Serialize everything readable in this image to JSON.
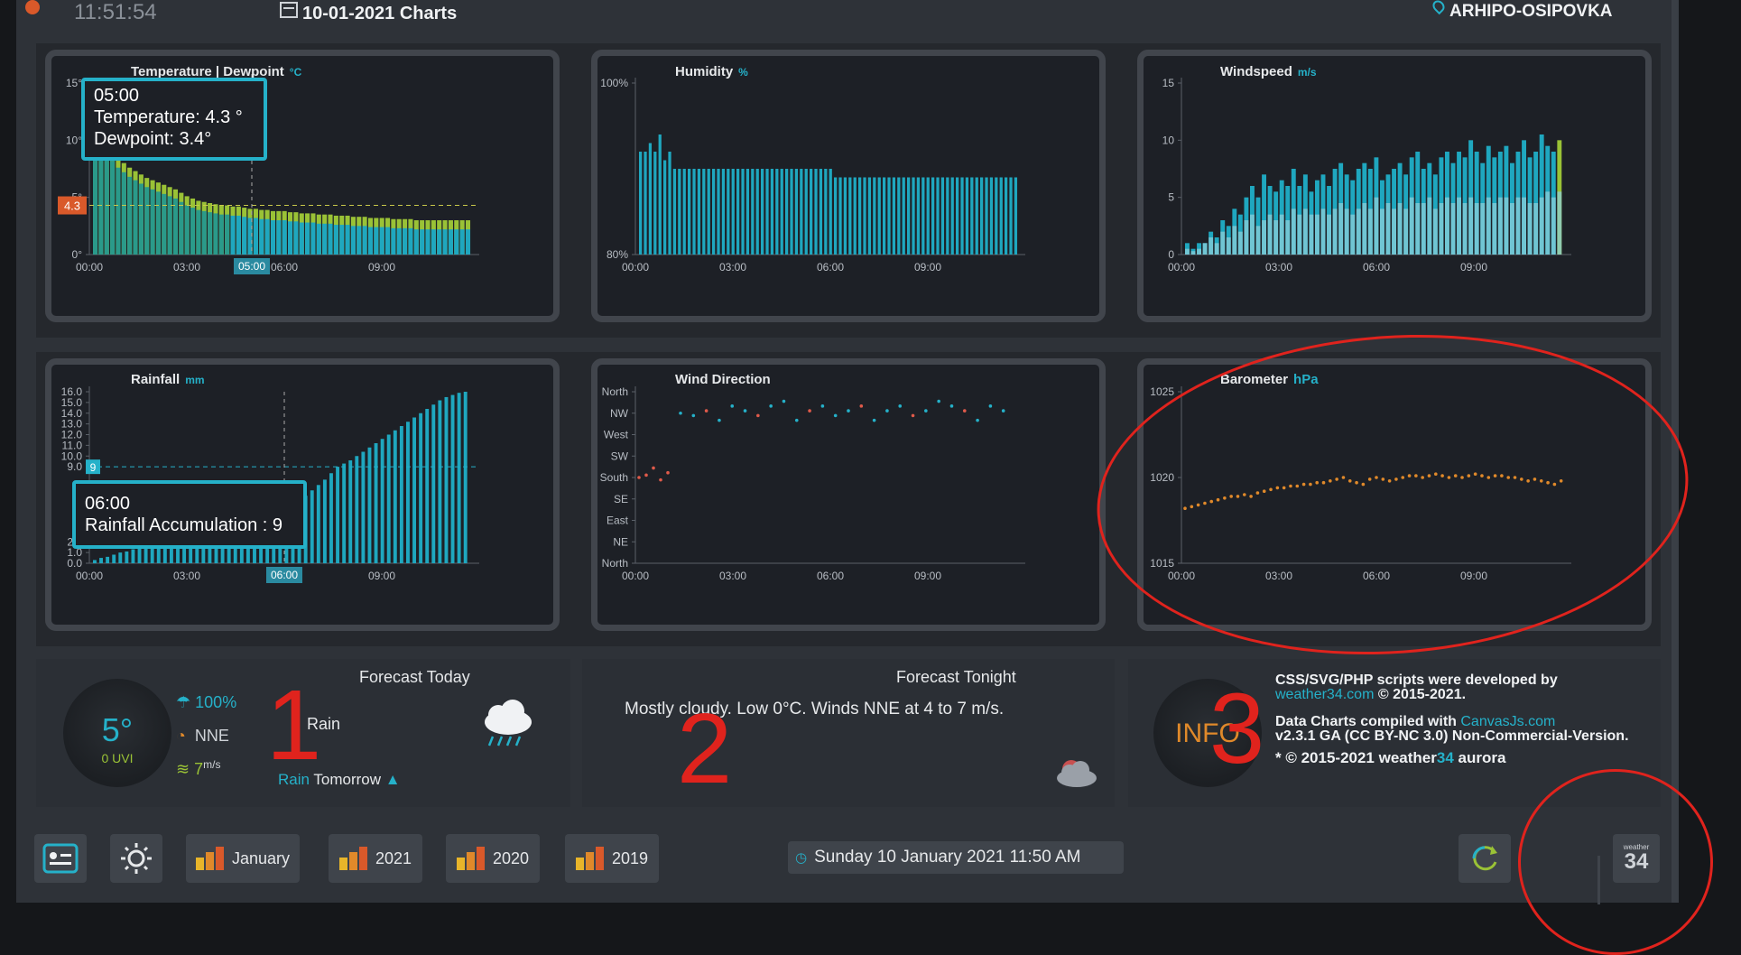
{
  "header": {
    "time": "11:51:54",
    "title": "10-01-2021 Charts",
    "location": "ARHIPO-OSIPOVKA"
  },
  "colors": {
    "accent": "#25b1c9",
    "temp_line": "#9ac236",
    "orange": "#e0892a",
    "red_anno": "#e0231d"
  },
  "charts": {
    "temperature": {
      "title": "Temperature | Dewpoint",
      "unit": "°C",
      "yticks": [
        "15°",
        "10°",
        "5°",
        "0°"
      ],
      "xticks": [
        "00:00",
        "03:00",
        "06:00",
        "09:00"
      ],
      "marker_value": "4.3",
      "x_highlight": "05:00",
      "tooltip": {
        "time": "05:00",
        "temp_line": "Temperature:  4.3 °",
        "dew_line": "Dewpoint:  3.4°"
      }
    },
    "humidity": {
      "title": "Humidity",
      "unit": "%",
      "yticks": [
        "100%",
        "80%"
      ],
      "xticks": [
        "00:00",
        "03:00",
        "06:00",
        "09:00"
      ]
    },
    "windspeed": {
      "title": "Windspeed",
      "unit": "m/s",
      "yticks": [
        "15",
        "10",
        "5",
        "0"
      ],
      "xticks": [
        "00:00",
        "03:00",
        "06:00",
        "09:00"
      ]
    },
    "rainfall": {
      "title": "Rainfall",
      "unit": "mm",
      "yticks": [
        "16.0",
        "15.0",
        "14.0",
        "13.0",
        "12.0",
        "11.0",
        "10.0",
        "9.0",
        "2.0",
        "1.0",
        "0.0"
      ],
      "xticks": [
        "00:00",
        "03:00",
        "06:00",
        "09:00"
      ],
      "marker_value": "9",
      "x_highlight": "06:00",
      "tooltip": {
        "time": "06:00",
        "line": "Rainfall Accumulation :  9"
      }
    },
    "wind_direction": {
      "title": "Wind Direction",
      "yticks": [
        "North",
        "NW",
        "West",
        "SW",
        "South",
        "SE",
        "East",
        "NE",
        "North"
      ],
      "xticks": [
        "00:00",
        "03:00",
        "06:00",
        "09:00"
      ]
    },
    "barometer": {
      "title": "Barometer",
      "unit": "hPa",
      "yticks": [
        "1025",
        "1020",
        "1015"
      ],
      "xticks": [
        "00:00",
        "03:00",
        "06:00",
        "09:00"
      ]
    }
  },
  "chart_data": [
    {
      "type": "bar",
      "title": "Temperature | Dewpoint",
      "x": "00:00-11:00 (10 min)",
      "series": [
        {
          "name": "Temperature",
          "values": [
            10.5,
            10.0,
            9.6,
            9.0,
            8.4,
            8.0,
            7.6,
            7.3,
            7.0,
            6.7,
            6.5,
            6.3,
            6.1,
            5.9,
            5.7,
            5.4,
            5.1,
            4.9,
            4.7,
            4.6,
            4.5,
            4.4,
            4.3,
            4.3,
            4.2,
            4.2,
            4.1,
            4.0,
            4.0,
            3.9,
            3.9,
            3.8,
            3.8,
            3.8,
            3.7,
            3.7,
            3.6,
            3.6,
            3.6,
            3.5,
            3.5,
            3.5,
            3.4,
            3.4,
            3.4,
            3.3,
            3.3,
            3.3,
            3.2,
            3.2,
            3.2,
            3.2,
            3.1,
            3.1,
            3.1,
            3.1,
            3.0,
            3.0,
            3.0,
            3.0,
            3.0,
            3.0,
            3.0,
            3.0,
            3.0,
            3.0
          ]
        }
      ],
      "ylim": [
        0,
        15
      ]
    },
    {
      "type": "bar",
      "title": "Humidity",
      "ylim": [
        80,
        100
      ],
      "values": [
        92,
        92,
        93,
        92,
        94,
        91,
        92,
        90,
        90,
        90,
        90,
        90,
        90,
        90,
        90,
        90,
        90,
        90,
        90,
        90,
        90,
        90,
        90,
        90,
        90,
        90,
        90,
        90,
        90,
        90,
        90,
        90,
        90,
        90,
        90,
        90,
        90,
        90,
        90,
        90,
        89,
        89,
        89,
        89,
        89,
        89,
        89,
        89,
        89,
        89,
        89,
        89,
        89,
        89,
        89,
        89,
        89,
        89,
        89,
        89,
        89,
        89,
        89,
        89,
        89,
        89,
        89,
        89,
        89,
        89,
        89,
        89,
        89,
        89,
        89,
        89,
        89,
        89
      ]
    },
    {
      "type": "bar",
      "title": "Windspeed",
      "ylim": [
        0,
        15
      ],
      "series": [
        {
          "name": "Gust",
          "values": [
            1,
            0.5,
            1,
            1,
            2,
            1.5,
            3,
            2.5,
            4,
            3.5,
            5,
            6,
            5,
            7,
            6,
            5.5,
            6.5,
            6,
            7.5,
            6,
            7,
            5.5,
            6.5,
            7,
            6,
            7.5,
            8,
            7,
            6.5,
            7.5,
            8,
            7.5,
            8.5,
            6.5,
            7,
            7.5,
            8,
            7,
            8.5,
            9,
            7.5,
            8,
            7,
            8.5,
            9,
            8,
            9,
            8.5,
            10,
            9,
            8,
            9.5,
            8.5,
            9,
            9.5,
            8,
            9,
            10,
            8.5,
            9,
            10.5,
            9.5,
            9,
            10
          ]
        },
        {
          "name": "Speed",
          "values": [
            0.5,
            0.3,
            0.5,
            1,
            1.5,
            1,
            2,
            1.5,
            2.5,
            2,
            3,
            3.5,
            2.5,
            3,
            3.5,
            3,
            3.5,
            3,
            4,
            3.5,
            4,
            3.5,
            3.5,
            4,
            3.5,
            4,
            4.5,
            4,
            3.5,
            4,
            4.5,
            4,
            5,
            4,
            4.5,
            4,
            4.5,
            4,
            5,
            4.5,
            4.5,
            5,
            4,
            4.5,
            5,
            4.5,
            5,
            4.5,
            5,
            4.5,
            4.5,
            5,
            4.5,
            5,
            5,
            4.5,
            5,
            5,
            4.5,
            4.5,
            5,
            5.5,
            5,
            5.5
          ]
        }
      ]
    },
    {
      "type": "bar",
      "title": "Rainfall",
      "ylim": [
        0,
        16
      ],
      "values": [
        0.3,
        0.5,
        0.6,
        0.8,
        1.0,
        1.1,
        1.3,
        1.4,
        1.5,
        1.7,
        1.8,
        1.9,
        2.0,
        2.1,
        2.2,
        2.3,
        2.4,
        2.5,
        2.6,
        2.7,
        2.8,
        2.9,
        3.1,
        3.3,
        3.5,
        3.7,
        3.9,
        4.2,
        4.5,
        4.8,
        5.1,
        5.5,
        5.9,
        6.3,
        6.8,
        7.3,
        7.8,
        8.4,
        9.0,
        9.3,
        9.6,
        10.0,
        10.4,
        10.8,
        11.2,
        11.6,
        12.0,
        12.4,
        12.8,
        13.2,
        13.6,
        14.0,
        14.4,
        14.8,
        15.2,
        15.5,
        15.7,
        15.9,
        16.0
      ]
    },
    {
      "type": "scatter",
      "title": "Wind Direction",
      "series": [
        {
          "name": "NW points",
          "values": [
            315,
            310,
            320,
            300,
            330,
            320,
            310,
            330,
            340,
            300,
            320,
            330,
            310,
            320,
            330,
            300,
            320,
            330,
            310,
            320,
            340,
            330,
            320,
            300,
            330,
            320
          ]
        },
        {
          "name": "South points",
          "values": [
            180,
            185,
            200,
            175,
            190
          ]
        }
      ]
    },
    {
      "type": "scatter",
      "title": "Barometer",
      "ylim": [
        1015,
        1025
      ],
      "values": [
        1018.2,
        1018.3,
        1018.4,
        1018.5,
        1018.6,
        1018.7,
        1018.8,
        1018.9,
        1018.9,
        1019.0,
        1018.9,
        1019.1,
        1019.2,
        1019.3,
        1019.4,
        1019.4,
        1019.5,
        1019.5,
        1019.6,
        1019.6,
        1019.7,
        1019.7,
        1019.8,
        1019.9,
        1020.0,
        1019.8,
        1019.7,
        1019.6,
        1019.9,
        1020.0,
        1019.9,
        1019.8,
        1019.9,
        1020.0,
        1020.1,
        1020.1,
        1020.0,
        1020.1,
        1020.2,
        1020.1,
        1020.0,
        1020.1,
        1020.0,
        1020.1,
        1020.2,
        1020.1,
        1020.0,
        1020.1,
        1020.1,
        1020.0,
        1020.0,
        1019.9,
        1019.8,
        1019.9,
        1019.8,
        1019.7,
        1019.6,
        1019.8
      ]
    }
  ],
  "panels": {
    "today": {
      "title": "Forecast Today",
      "temp": "5°",
      "uvi": "0 UVI",
      "humidity": "100%",
      "wind_dir": "NNE",
      "wind_speed": "7",
      "wind_unit": "m/s",
      "forecast_word": "Rain",
      "tomorrow_rain": "Rain",
      "tomorrow_label": "Tomorrow"
    },
    "tonight": {
      "title": "Forecast Tonight",
      "text": "Mostly cloudy. Low 0°C. Winds NNE at 4 to 7 m/s."
    },
    "info": {
      "circle_text": "INFO",
      "line1": "CSS/SVG/PHP scripts were developed by",
      "link1": "weather34.com",
      "copy1": "© 2015-2021.",
      "line2": "Data Charts compiled with",
      "link2": "CanvasJs.com",
      "line3": "v2.3.1 GA (CC BY-NC 3.0) Non-Commercial-Version.",
      "footer_prefix": "* © 2015-2021 weather",
      "footer_num": "34",
      "footer_suffix": "aurora"
    }
  },
  "annotations": {
    "one": "1",
    "two": "2",
    "three": "3"
  },
  "toolbar": {
    "january": "January",
    "y2021": "2021",
    "y2020": "2020",
    "y2019": "2019",
    "datetime": "Sunday 10 January 2021 11:50 AM",
    "logo_top": "weather",
    "logo_num": "34"
  }
}
